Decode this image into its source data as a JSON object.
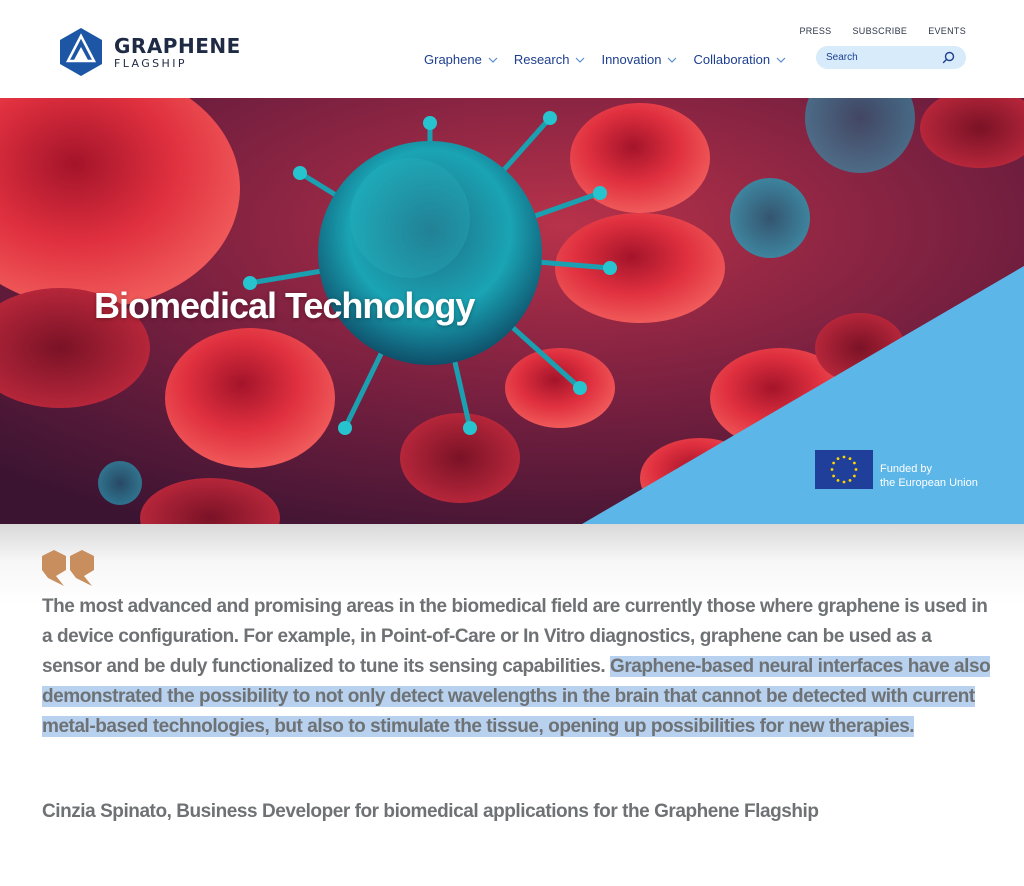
{
  "header": {
    "logo": {
      "line1": "GRAPHENE",
      "line2": "FLAGSHIP"
    },
    "utility_links": [
      "PRESS",
      "SUBSCRIBE",
      "EVENTS"
    ],
    "nav": [
      {
        "label": "Graphene"
      },
      {
        "label": "Research"
      },
      {
        "label": "Innovation"
      },
      {
        "label": "Collaboration"
      }
    ],
    "search": {
      "placeholder": "Search"
    }
  },
  "hero": {
    "title": "Biomedical Technology",
    "eu_badge": {
      "line1": "Funded by",
      "line2": "the European Union"
    }
  },
  "quote": {
    "text_plain": "The most advanced and promising areas in the biomedical field are currently those where graphene is used in a device configuration. For example, in Point-of-Care or In Vitro diagnostics, graphene can be used as a sensor and be duly functionalized to tune its sensing capabilities. ",
    "text_highlighted": "Graphene-based neural interfaces have also demonstrated the possibility to not only detect wavelengths in the brain that cannot be detected with current metal-based technologies, but also to stimulate the tissue, opening up possibilities for new therapies.",
    "attribution": "Cinzia Spinato, Business Developer for biomedical applications for the Graphene Flagship"
  },
  "colors": {
    "brand_blue": "#1d3f8f",
    "quote_text": "#6e7274",
    "highlight": "#b7d1ef",
    "eu_triangle": "#5cb6e8",
    "quote_mark": "#c98e5e"
  },
  "icons": {
    "logo_mark": "hexagon-logo-icon",
    "nav_chevron": "chevron-down-icon",
    "search": "search-icon",
    "quote": "quote-mark-icon",
    "eu_flag": "eu-flag-icon"
  }
}
